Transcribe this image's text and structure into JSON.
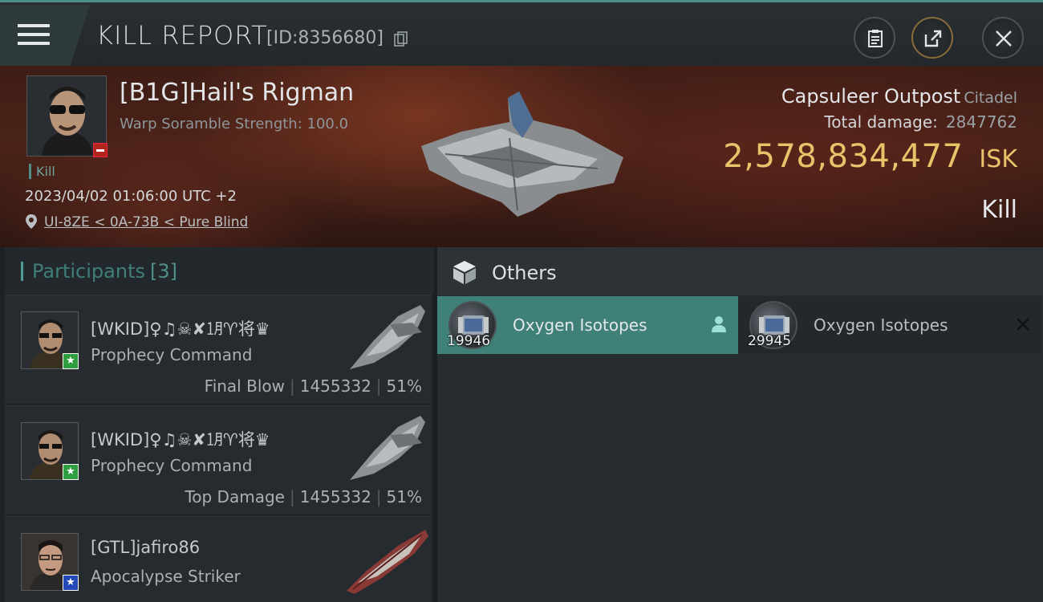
{
  "header": {
    "title": "KILL REPORT",
    "report_id": "[ID:8356680]"
  },
  "victim": {
    "name": "[B1G]Hail's Rigman",
    "subtitle": "Warp Soramble Strength: 100.0",
    "kill_tag": "Kill",
    "timestamp": "2023/04/02 01:06:00 UTC +2",
    "location": "UI-8ZE < 0A-73B < Pure Blind",
    "structure_name": "Capsuleer Outpost",
    "structure_class": "Citadel",
    "total_damage_label": "Total damage:",
    "total_damage": "2847762",
    "isk_value": "2,578,834,477",
    "isk_unit": "ISK",
    "result": "Kill"
  },
  "participants": {
    "title": "Participants",
    "count": "[3]",
    "items": [
      {
        "name": "[WKID]♀♫☠✘㋀♈将♛",
        "ship": "Prophecy Command",
        "role": "Final Blow",
        "damage": "1455332",
        "percent": "51%",
        "badge": "★"
      },
      {
        "name": "[WKID]♀♫☠✘㋀♈将♛",
        "ship": "Prophecy Command",
        "role": "Top Damage",
        "damage": "1455332",
        "percent": "51%",
        "badge": "★"
      },
      {
        "name": "[GTL]jafiro86",
        "ship": "Apocalypse Striker",
        "badge": "★"
      }
    ]
  },
  "others": {
    "title": "Others",
    "items": [
      {
        "name": "Oxygen Isotopes",
        "qty": "19946"
      },
      {
        "name": "Oxygen Isotopes",
        "qty": "29945"
      }
    ]
  },
  "colors": {
    "accent_teal": "#4f9c94",
    "isk_gold": "#e8c36a",
    "corp_red": "#b3261e"
  }
}
